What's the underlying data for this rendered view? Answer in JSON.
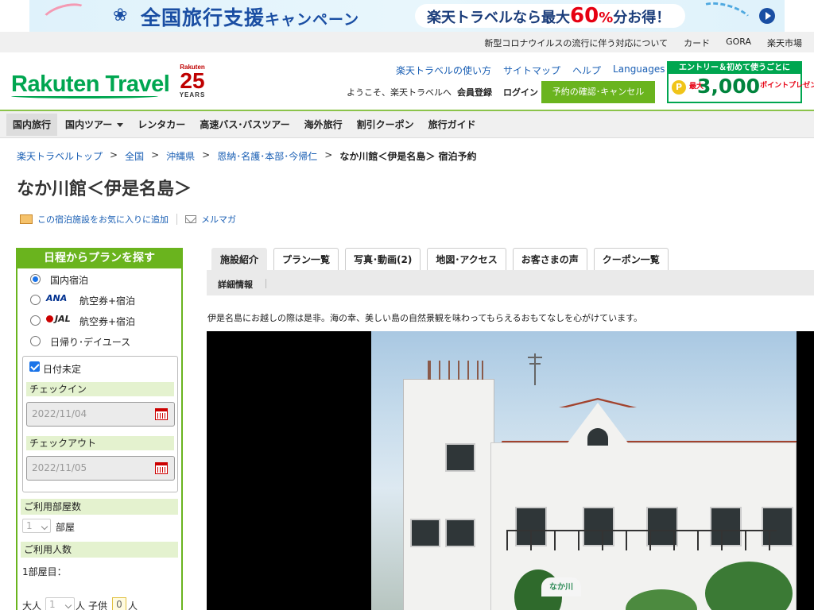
{
  "banner": {
    "title_main": "全国旅行支援",
    "title_sub": "キャンペーン",
    "promo_prefix": "楽天トラベルなら最大",
    "promo_number": "60",
    "promo_percent": "%",
    "promo_suffix": "分お得！"
  },
  "utility": {
    "links": [
      "新型コロナウイルスの流行に伴う対応について",
      "カード",
      "GORA",
      "楽天市場"
    ]
  },
  "header": {
    "logo": "Rakuten Travel",
    "anniv_brand": "Rakuten",
    "anniv_number": "25",
    "anniv_years": "YEARS",
    "links": [
      "楽天トラベルの使い方",
      "サイトマップ",
      "ヘルプ",
      "Languages"
    ],
    "greeting": "ようこそ、楽天トラベルへ",
    "member": "会員登録",
    "login": "ログイン",
    "reservation_button": "予約の確認･キャンセル",
    "promo_top": "エントリー＆初めて使うごとに",
    "promo_coin": "P",
    "promo_prefix": "最大",
    "promo_amount": "3,000",
    "promo_suffix": "ポイントプレゼント"
  },
  "nav": {
    "items": [
      "国内旅行",
      "国内ツアー",
      "レンタカー",
      "高速バス･バスツアー",
      "海外旅行",
      "割引クーポン",
      "旅行ガイド"
    ]
  },
  "breadcrumb": {
    "items": [
      "楽天トラベルトップ",
      "全国",
      "沖縄県",
      "恩納･名護･本部･今帰仁"
    ],
    "separator": ">",
    "current": "なか川館＜伊是名島＞ 宿泊予約"
  },
  "page": {
    "title": "なか川館＜伊是名島＞",
    "favorite": "この宿泊施設をお気に入りに追加",
    "mailmag": "メルマガ"
  },
  "sidebar": {
    "title": "日程からプランを探す",
    "options": {
      "domestic": "国内宿泊",
      "ana_logo": "ANA",
      "ana_label": "航空券+宿泊",
      "jal_logo": "JAL",
      "jal_label": "航空券+宿泊",
      "dayuse": "日帰り･デイユース"
    },
    "undecided": "日付未定",
    "checkin_label": "チェックイン",
    "checkin_value": "2022/11/04",
    "checkout_label": "チェックアウト",
    "checkout_value": "2022/11/05",
    "rooms_label": "ご利用部屋数",
    "rooms_value": "1",
    "rooms_unit": "部屋",
    "guests_label": "ご利用人数",
    "room1_label": "1部屋目：",
    "adult_label": "大人",
    "adult_value": "1",
    "adult_unit": "人",
    "child_label": "子供",
    "child_value": "0",
    "child_unit": "人"
  },
  "tabs": {
    "items": [
      "施設紹介",
      "プラン一覧",
      "写真･動画(2)",
      "地図･アクセス",
      "お客さまの声",
      "クーポン一覧"
    ],
    "active": "施設紹介",
    "subtab": "詳細情報"
  },
  "description": "伊是名島にお越しの際は是非。海の幸、美しい島の自然景観を味わってもらえるおもてなしを心がけています。",
  "photo": {
    "sign_text": "なか川"
  },
  "colors": {
    "brand_green": "#00a650",
    "accent_green": "#6ab41e",
    "link_blue": "#1a5fb4",
    "banner_blue": "#1a4ea3",
    "sale_red": "#e60012"
  }
}
